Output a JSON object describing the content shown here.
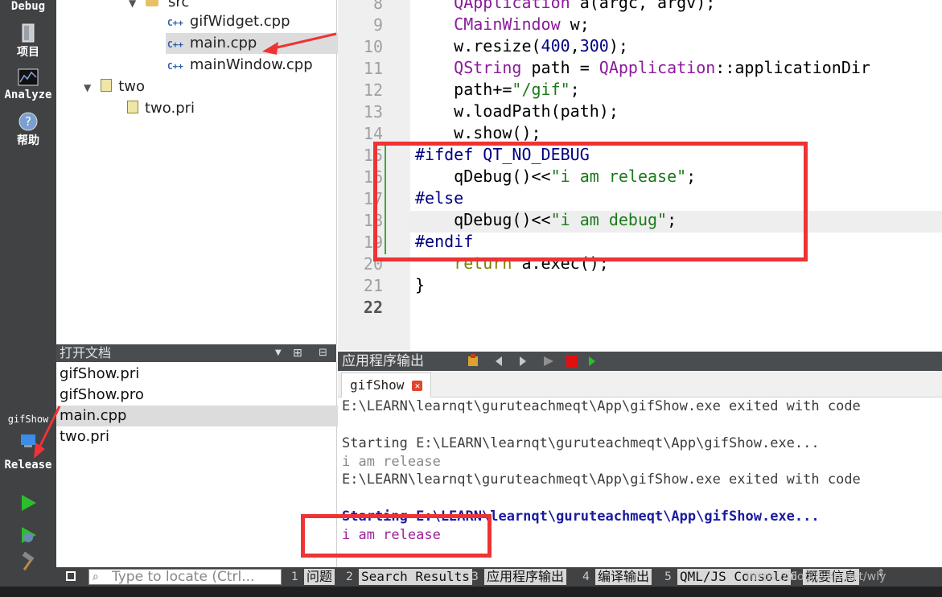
{
  "modebar": {
    "debug_label": "Debug",
    "project_label": "项目",
    "analyze_label": "Analyze",
    "help_label": "帮助",
    "target_project": "gifShow",
    "target_config": "Release"
  },
  "tree": {
    "top_folder": "src",
    "items": [
      {
        "type": "C++",
        "label": "gifWidget.cpp"
      },
      {
        "type": "C++",
        "label": "main.cpp"
      },
      {
        "type": "C++",
        "label": "mainWindow.cpp"
      }
    ],
    "sub_project": "two",
    "sub_item": "two.pri"
  },
  "opendocs": {
    "title": "打开文档",
    "items": [
      "gifShow.pri",
      "gifShow.pro",
      "main.cpp",
      "two.pri"
    ]
  },
  "editor": {
    "line_numbers": [
      "8",
      "9",
      "10",
      "11",
      "12",
      "13",
      "14",
      "15",
      "16",
      "17",
      "18",
      "19",
      "20",
      "21",
      "22"
    ],
    "lines": [
      {
        "a": "    QApplication",
        "b": " a(argc, argv);"
      },
      {
        "a": "    CMainWindow",
        "b": " w;"
      },
      {
        "a": "    w.resize(",
        "n1": "400",
        "c": ",",
        "n2": "300",
        "d": ");"
      },
      {
        "a": "    QString",
        "b": " path = ",
        "c": "QApplication",
        "d": "::applicationDir"
      },
      {
        "a": "    path+=",
        "s": "\"/gif\"",
        "d": ";"
      },
      {
        "a": "    w.loadPath(path);"
      },
      {
        "a": "    w.show();"
      },
      {
        "p": "#ifdef QT_NO_DEBUG"
      },
      {
        "a": "    qDebug()<<",
        "s": "\"i am release\"",
        "d": ";"
      },
      {
        "p": "#else"
      },
      {
        "a": "    qDebug()<<",
        "s": "\"i am debug\"",
        "d": ";"
      },
      {
        "p": "#endif"
      },
      {
        "k": "    return",
        "b": " a.exec();"
      },
      {
        "a": "}"
      },
      {
        "a": ""
      }
    ]
  },
  "output": {
    "title": "应用程序输出",
    "tab_label": "gifShow",
    "lines": [
      {
        "text": "E:\\LEARN\\learnqt\\guruteachmeqt\\App\\gifShow.exe exited with code",
        "color": "#3c3c3c"
      },
      {
        "text": "",
        "color": "#3c3c3c"
      },
      {
        "text": "Starting E:\\LEARN\\learnqt\\guruteachmeqt\\App\\gifShow.exe...",
        "color": "#3c3c3c"
      },
      {
        "text": "i am release",
        "color": "#8a8a8a"
      },
      {
        "text": "E:\\LEARN\\learnqt\\guruteachmeqt\\App\\gifShow.exe exited with code",
        "color": "#3c3c3c"
      },
      {
        "text": "",
        "color": "#3c3c3c"
      },
      {
        "text": "Starting E:\\LEARN\\learnqt\\guruteachmeqt\\App\\gifShow.exe...",
        "color": "#1a1aa0"
      },
      {
        "text": "i am release",
        "color": "#a0209a"
      }
    ]
  },
  "statusbar": {
    "locate_placeholder": "Type to locate (Ctrl...",
    "tabs": [
      {
        "num": "1",
        "label": "问题"
      },
      {
        "num": "2",
        "label": "Search Results"
      },
      {
        "num": "3",
        "label": "应用程序输出"
      },
      {
        "num": "4",
        "label": "编译输出"
      },
      {
        "num": "5",
        "label": "QML/JS Console"
      },
      {
        "num": "6",
        "label": "概要信息"
      }
    ],
    "watermark": "https://blog.csdn.net/wly"
  },
  "colors": {
    "annotation_red": "#ee3333",
    "keyword_purple": "#8b1a9b",
    "type_purple": "#8b1a9b",
    "string_green": "#1a7a1a",
    "number_navy": "#000080",
    "preproc_navy": "#000080"
  }
}
